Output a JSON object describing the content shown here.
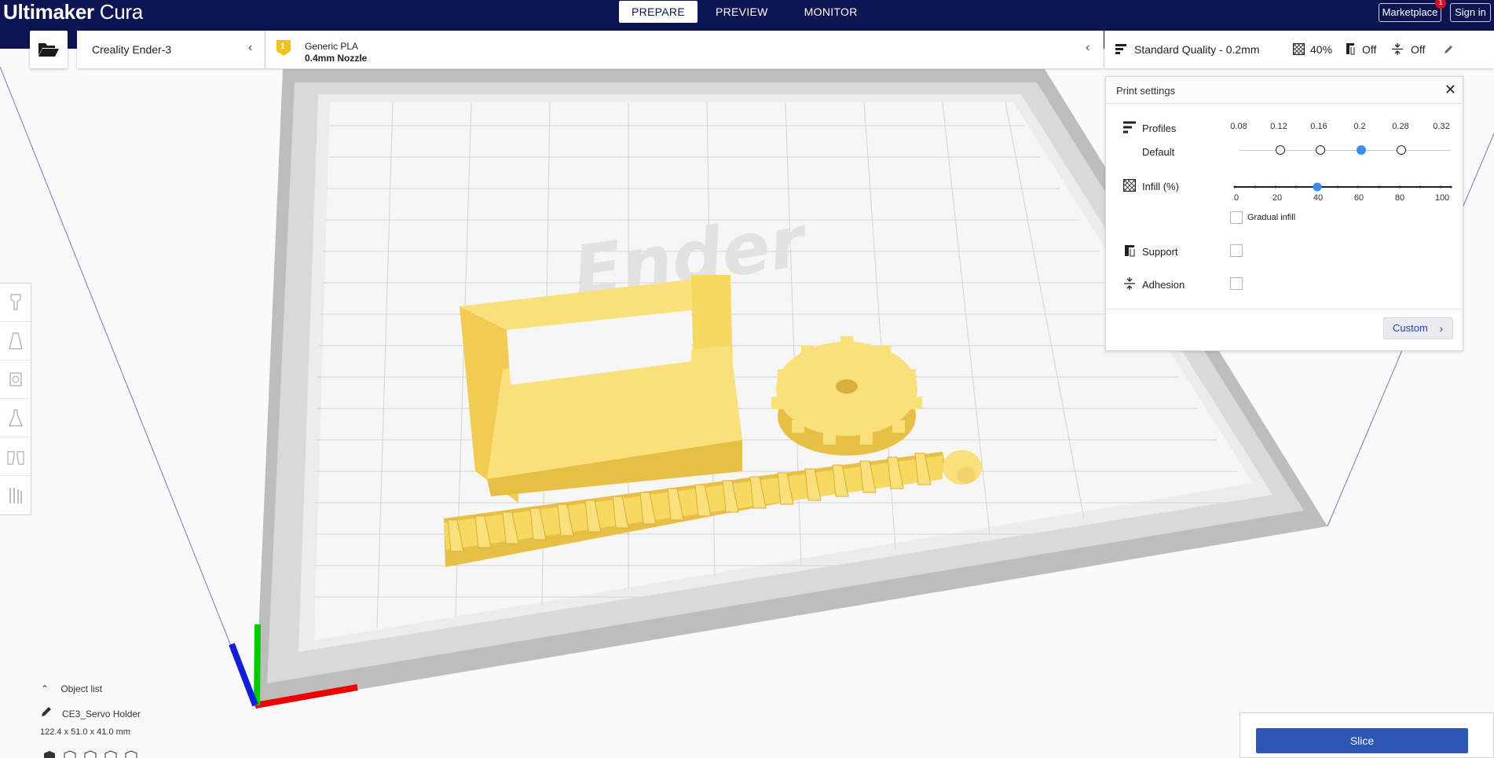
{
  "app": {
    "brand_bold": "Ultimaker",
    "brand_light": "Cura"
  },
  "stages": [
    {
      "label": "PREPARE",
      "active": true
    },
    {
      "label": "PREVIEW",
      "active": false
    },
    {
      "label": "MONITOR",
      "active": false
    }
  ],
  "topbar": {
    "marketplace_label": "Marketplace",
    "marketplace_badge": "1",
    "signin_label": "Sign in"
  },
  "printer": {
    "name": "Creality Ender-3"
  },
  "material": {
    "extruder_number": "1",
    "name": "Generic PLA",
    "nozzle": "0.4mm Nozzle"
  },
  "quality_bar": {
    "profile": "Standard Quality - 0.2mm",
    "infill": "40%",
    "support": "Off",
    "adhesion": "Off"
  },
  "print_settings": {
    "title": "Print settings",
    "profiles_label": "Profiles",
    "profile_name": "Default",
    "layer_heights": [
      "0.08",
      "0.12",
      "0.16",
      "0.2",
      "0.28",
      "0.32"
    ],
    "selected_layer_height": "0.2",
    "infill_label": "Infill (%)",
    "infill_ticks": [
      "0",
      "20",
      "40",
      "60",
      "80",
      "100"
    ],
    "infill_value": 40,
    "gradual_infill_label": "Gradual infill",
    "gradual_infill_checked": false,
    "support_label": "Support",
    "support_checked": false,
    "adhesion_label": "Adhesion",
    "adhesion_checked": false,
    "custom_label": "Custom"
  },
  "object_list": {
    "header": "Object list",
    "object_name": "CE3_Servo Holder",
    "dimensions": "122.4 x 51.0 x 41.0 mm"
  },
  "slice": {
    "button_label": "Slice"
  },
  "colors": {
    "topbar": "#0c1451",
    "accent_blue": "#2d55b4",
    "model_yellow": "#f7d55c",
    "slider_active": "#3c8df2"
  },
  "icons": [
    "folder-open-icon",
    "chevron-left-icon",
    "quality-icon",
    "infill-icon",
    "support-icon",
    "adhesion-icon",
    "pencil-icon",
    "close-icon",
    "chevron-right-icon",
    "chevron-up-icon",
    "edit-icon"
  ]
}
